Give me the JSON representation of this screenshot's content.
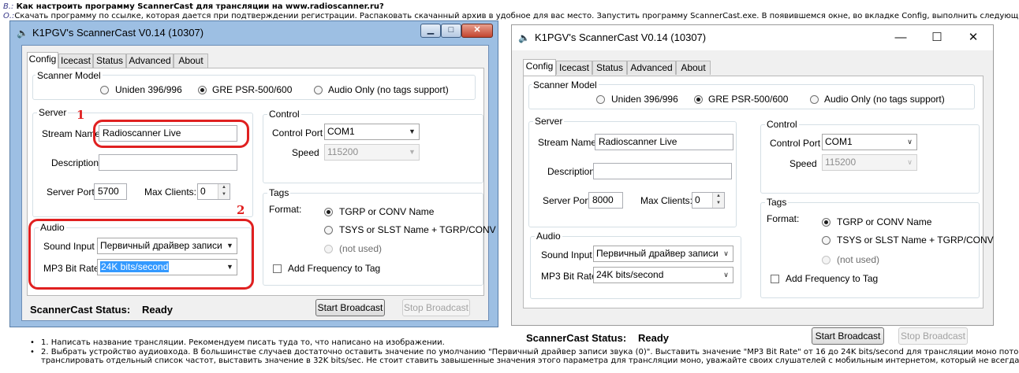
{
  "header": {
    "q_prefix": "В.:",
    "q_text": "Как настроить программу ScannerCast для трансляции на www.radioscanner.ru?",
    "a_prefix": "О.:",
    "a_text": "Скачать программу по ссылке, которая дается при подтверждении регистрации. Распаковать скачанный архив в удобное для вас место. Запустить программу ScannerCast.exe. В появившемся окне, во вкладке Config, выполнить следующие"
  },
  "annotations": {
    "marker1": "1",
    "marker2": "2"
  },
  "icons": {
    "speaker": "speaker-icon",
    "minimize": "minimize-icon",
    "maximize": "maximize-icon",
    "close": "close-icon"
  },
  "colors": {
    "annotation_red": "#e02020",
    "win7_frame": "#9dbfe3",
    "selection": "#3399ff"
  },
  "left_window": {
    "title": "K1PGV's ScannerCast V0.14 (10307)",
    "tabs": [
      "Config",
      "Icecast",
      "Status",
      "Advanced",
      "About"
    ],
    "selected_tab": "Config",
    "scanner_model": {
      "legend": "Scanner Model",
      "options": [
        "Uniden 396/996",
        "GRE PSR-500/600",
        "Audio Only (no tags support)"
      ],
      "selected": "GRE PSR-500/600"
    },
    "server": {
      "legend": "Server",
      "stream_name_label": "Stream Name",
      "stream_name": "Radioscanner Live",
      "description_label": "Description",
      "description": "",
      "port_label": "Server Port",
      "port": "5700",
      "max_clients_label": "Max Clients:",
      "max_clients": "0"
    },
    "control": {
      "legend": "Control",
      "port_label": "Control Port",
      "port": "COM1",
      "speed_label": "Speed",
      "speed": "115200"
    },
    "audio": {
      "legend": "Audio",
      "sound_input_label": "Sound Input",
      "sound_input": "Первичный драйвер записи зв",
      "bitrate_label": "MP3 Bit Rate",
      "bitrate": "24K bits/second"
    },
    "tags": {
      "legend": "Tags",
      "format_label": "Format:",
      "options": [
        "TGRP or CONV Name",
        "TSYS or SLST Name + TGRP/CONV",
        "(not used)"
      ],
      "selected": "TGRP or CONV Name",
      "add_freq_label": "Add Frequency to Tag",
      "add_freq_checked": false
    },
    "status_label": "ScannerCast Status:",
    "status_value": "Ready",
    "start_button": "Start Broadcast",
    "stop_button": "Stop Broadcast"
  },
  "right_window": {
    "title": "K1PGV's ScannerCast V0.14 (10307)",
    "tabs": [
      "Config",
      "Icecast",
      "Status",
      "Advanced",
      "About"
    ],
    "selected_tab": "Config",
    "scanner_model": {
      "legend": "Scanner Model",
      "options": [
        "Uniden 396/996",
        "GRE PSR-500/600",
        "Audio Only (no tags support)"
      ],
      "selected": "GRE PSR-500/600"
    },
    "server": {
      "legend": "Server",
      "stream_name_label": "Stream Name",
      "stream_name": "Radioscanner Live",
      "description_label": "Description",
      "description": "",
      "port_label": "Server Port",
      "port": "8000",
      "max_clients_label": "Max Clients:",
      "max_clients": "0"
    },
    "control": {
      "legend": "Control",
      "port_label": "Control Port",
      "port": "COM1",
      "speed_label": "Speed",
      "speed": "115200"
    },
    "audio": {
      "legend": "Audio",
      "sound_input_label": "Sound Input",
      "sound_input": "Первичный драйвер записи зв",
      "bitrate_label": "MP3 Bit Rate",
      "bitrate": "24K bits/second"
    },
    "tags": {
      "legend": "Tags",
      "format_label": "Format:",
      "options": [
        "TGRP or CONV Name",
        "TSYS or SLST Name + TGRP/CONV",
        "(not used)"
      ],
      "selected": "TGRP or CONV Name",
      "add_freq_label": "Add Frequency to Tag",
      "add_freq_checked": false
    },
    "status_label": "ScannerCast Status:",
    "status_value": "Ready",
    "start_button": "Start Broadcast",
    "stop_button": "Stop Broadcast"
  },
  "notes": [
    "1. Написать название трансляции. Рекомендуем писать туда то, что написано на изображении.",
    "2. Выбрать устройство аудиовхода. В большинстве случаев достаточно оставить значение по умолчанию \"Первичный драйвер записи звука (0)\". Выставить значение \"MP3 Bit Rate\" от 16 до 24K bits/second для трансляции моно потока.",
    "транслировать отдельный список частот, выставить значение в 32K bits/sec. Не стоит ставить завышенные значения этого параметра для трансляции моно, уважайте своих слушателей с мобильным интернетом, который не всегда деше"
  ]
}
